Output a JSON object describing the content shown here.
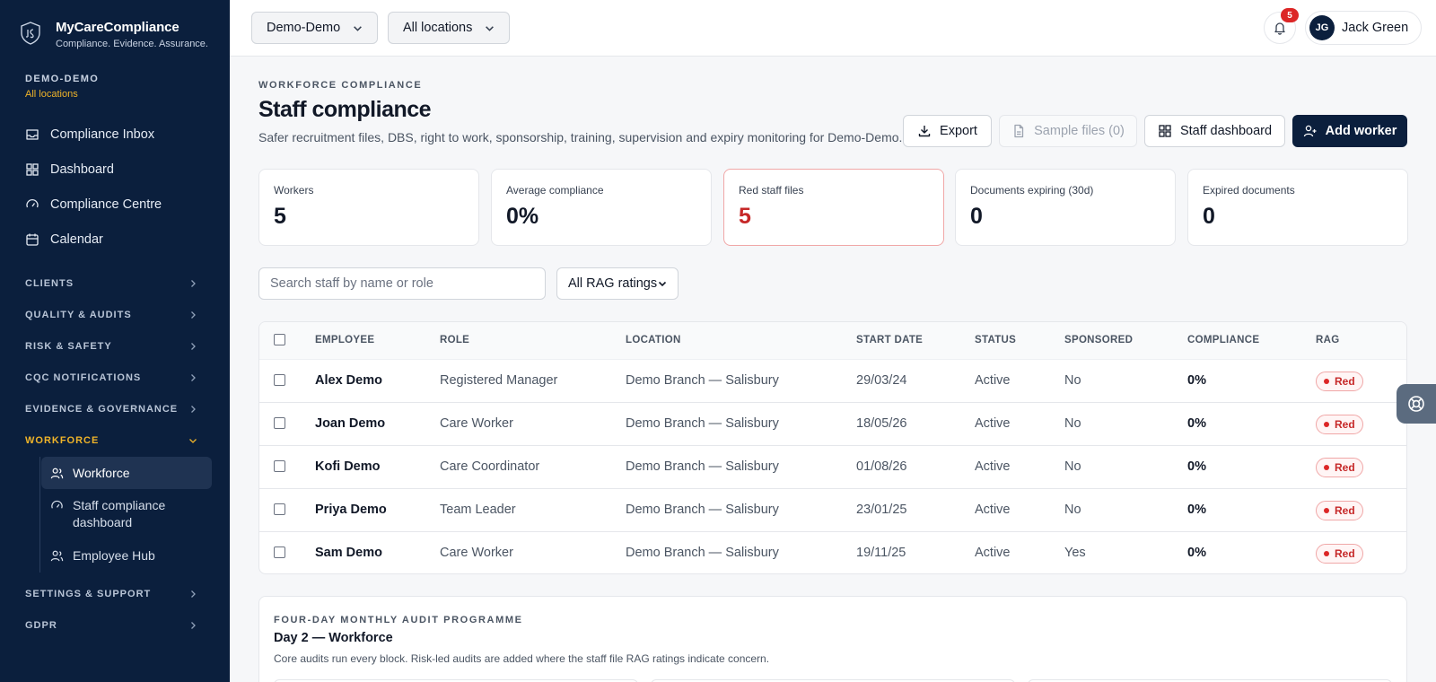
{
  "brand": {
    "name": "MyCareCompliance",
    "tagline": "Compliance. Evidence. Assurance."
  },
  "org": {
    "name": "DEMO-DEMO",
    "location": "All locations"
  },
  "nav": {
    "top": [
      {
        "label": "Compliance Inbox",
        "icon": "inbox-icon"
      },
      {
        "label": "Dashboard",
        "icon": "grid-icon"
      },
      {
        "label": "Compliance Centre",
        "icon": "gauge-icon"
      },
      {
        "label": "Calendar",
        "icon": "calendar-icon"
      }
    ],
    "sections": [
      "CLIENTS",
      "QUALITY & AUDITS",
      "RISK & SAFETY",
      "CQC NOTIFICATIONS",
      "EVIDENCE & GOVERNANCE",
      "WORKFORCE"
    ],
    "workforce_items": [
      {
        "label": "Workforce",
        "icon": "users-icon",
        "active": true
      },
      {
        "label": "Staff compliance dashboard",
        "icon": "gauge-icon",
        "active": false
      },
      {
        "label": "Employee Hub",
        "icon": "users-icon",
        "active": false
      }
    ],
    "sections_bottom": [
      "SETTINGS & SUPPORT",
      "GDPR"
    ]
  },
  "topbar": {
    "org_select": "Demo-Demo",
    "location_select": "All locations",
    "notifications": "5",
    "user_initials": "JG",
    "user_name": "Jack Green"
  },
  "header": {
    "eyebrow": "WORKFORCE COMPLIANCE",
    "title": "Staff compliance",
    "subtitle": "Safer recruitment files, DBS, right to work, sponsorship, training, supervision and expiry monitoring for Demo-Demo."
  },
  "actions": {
    "export": "Export",
    "sample_files": "Sample files (0)",
    "staff_dashboard": "Staff dashboard",
    "add_worker": "Add worker"
  },
  "stats": [
    {
      "label": "Workers",
      "value": "5"
    },
    {
      "label": "Average compliance",
      "value": "0%"
    },
    {
      "label": "Red staff files",
      "value": "5"
    },
    {
      "label": "Documents expiring (30d)",
      "value": "0"
    },
    {
      "label": "Expired documents",
      "value": "0"
    }
  ],
  "filters": {
    "search_placeholder": "Search staff by name or role",
    "rag_select": "All RAG ratings"
  },
  "table": {
    "columns": [
      "EMPLOYEE",
      "ROLE",
      "LOCATION",
      "START DATE",
      "STATUS",
      "SPONSORED",
      "COMPLIANCE",
      "RAG"
    ],
    "rows": [
      {
        "employee": "Alex Demo",
        "role": "Registered Manager",
        "location": "Demo Branch — Salisbury",
        "start_date": "29/03/24",
        "status": "Active",
        "sponsored": "No",
        "compliance": "0%",
        "rag": "Red"
      },
      {
        "employee": "Joan Demo",
        "role": "Care Worker",
        "location": "Demo Branch — Salisbury",
        "start_date": "18/05/26",
        "status": "Active",
        "sponsored": "No",
        "compliance": "0%",
        "rag": "Red"
      },
      {
        "employee": "Kofi Demo",
        "role": "Care Coordinator",
        "location": "Demo Branch — Salisbury",
        "start_date": "01/08/26",
        "status": "Active",
        "sponsored": "No",
        "compliance": "0%",
        "rag": "Red"
      },
      {
        "employee": "Priya Demo",
        "role": "Team Leader",
        "location": "Demo Branch — Salisbury",
        "start_date": "23/01/25",
        "status": "Active",
        "sponsored": "No",
        "compliance": "0%",
        "rag": "Red"
      },
      {
        "employee": "Sam Demo",
        "role": "Care Worker",
        "location": "Demo Branch — Salisbury",
        "start_date": "19/11/25",
        "status": "Active",
        "sponsored": "Yes",
        "compliance": "0%",
        "rag": "Red"
      }
    ]
  },
  "audit": {
    "eyebrow": "FOUR-DAY MONTHLY AUDIT PROGRAMME",
    "title": "Day 2 — Workforce",
    "subtitle": "Core audits run every block. Risk-led audits are added where the staff file RAG ratings indicate concern."
  },
  "colors": {
    "sidebar": "#0b1f3d",
    "accent": "#f0b429",
    "danger": "#c62828",
    "primary": "#0b1f3d"
  }
}
